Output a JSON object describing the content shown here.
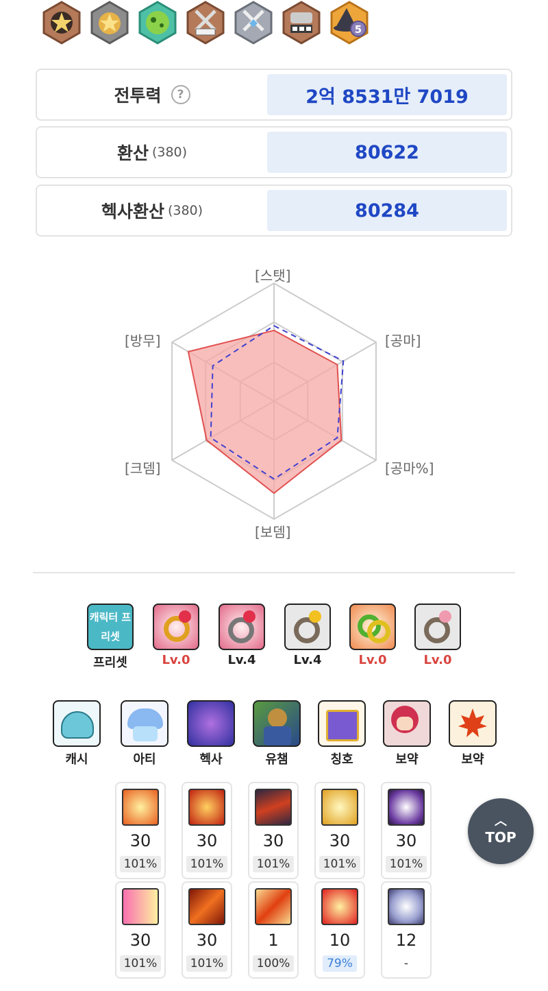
{
  "medals": [
    {
      "icon": "star-medal-bronze-icon",
      "color": "#b07050"
    },
    {
      "icon": "star-medal-silver-icon",
      "color": "#8a8a8a"
    },
    {
      "icon": "green-orb-medal-icon",
      "color": "#4cb8a0"
    },
    {
      "icon": "crossed-swords-medal-bronze-icon",
      "color": "#b07050"
    },
    {
      "icon": "crossed-swords-medal-silver-icon",
      "color": "#9aa0aa"
    },
    {
      "icon": "helmet-medal-bronze-icon",
      "color": "#b07050"
    },
    {
      "icon": "witch-hat-medal-icon",
      "color": "#e0a030",
      "badge": "5"
    }
  ],
  "stats": [
    {
      "label": "전투력",
      "sub": "",
      "value": "2억 8531만 7019",
      "help": "?"
    },
    {
      "label": "환산",
      "sub": "(380)",
      "value": "80622"
    },
    {
      "label": "헥사환산",
      "sub": "(380)",
      "value": "80284"
    }
  ],
  "radar": {
    "labels": [
      "[스탯]",
      "[공마]",
      "[공마%]",
      "[보뎀]",
      "[크뎀]",
      "[방무]"
    ],
    "filled": [
      0.6,
      0.62,
      0.66,
      0.78,
      0.66,
      0.84
    ],
    "dashed": [
      0.64,
      0.68,
      0.62,
      0.66,
      0.62,
      0.6
    ],
    "colors": {
      "filled": "#f5a8a5",
      "filled_stroke": "#e05050",
      "dashed": "#4040d0",
      "grid": "#cccccc"
    }
  },
  "row1": [
    {
      "icon": "character-preset-icon",
      "label": "프리셋",
      "red": false,
      "text": "캐릭터 프리셋"
    },
    {
      "icon": "gold-ring-icon",
      "label": "Lv.0",
      "red": true
    },
    {
      "icon": "silver-ruby-ring-icon",
      "label": "Lv.4",
      "red": false
    },
    {
      "icon": "topaz-ring-icon",
      "label": "Lv.4",
      "red": false
    },
    {
      "icon": "green-ring-icon",
      "label": "Lv.0",
      "red": true
    },
    {
      "icon": "pink-ring-icon",
      "label": "Lv.0",
      "red": true
    }
  ],
  "row2": [
    {
      "icon": "cash-helmet-icon",
      "label": "캐시"
    },
    {
      "icon": "mushroom-icon",
      "label": "아티"
    },
    {
      "icon": "hexa-swirl-icon",
      "label": "헥사"
    },
    {
      "icon": "union-champion-icon",
      "label": "유챔"
    },
    {
      "icon": "title-book-icon",
      "label": "칭호"
    },
    {
      "icon": "doping-character-icon",
      "label": "보약"
    },
    {
      "icon": "maple-leaf-icon",
      "label": "보약"
    }
  ],
  "skills": [
    {
      "icon": "skill-fire-burst-icon",
      "level": "30",
      "pct": "101%",
      "style": "grey"
    },
    {
      "icon": "skill-phoenix-icon",
      "level": "30",
      "pct": "101%",
      "style": "grey"
    },
    {
      "icon": "skill-dark-slash-icon",
      "level": "30",
      "pct": "101%",
      "style": "grey"
    },
    {
      "icon": "skill-golden-wing-icon",
      "level": "30",
      "pct": "101%",
      "style": "grey"
    },
    {
      "icon": "skill-crystal-icon",
      "level": "30",
      "pct": "101%",
      "style": "grey"
    },
    {
      "icon": "skill-arrow-rain-icon",
      "level": "30",
      "pct": "101%",
      "style": "grey"
    },
    {
      "icon": "skill-flame-spear-icon",
      "level": "30",
      "pct": "101%",
      "style": "grey"
    },
    {
      "icon": "skill-sword-icon",
      "level": "1",
      "pct": "100%",
      "style": "grey"
    },
    {
      "icon": "skill-heart-flame-icon",
      "level": "10",
      "pct": "79%",
      "style": "blue"
    },
    {
      "icon": "skill-orb-ring-icon",
      "level": "12",
      "pct": "-",
      "style": "plain"
    }
  ],
  "top_button": {
    "label": "TOP"
  }
}
